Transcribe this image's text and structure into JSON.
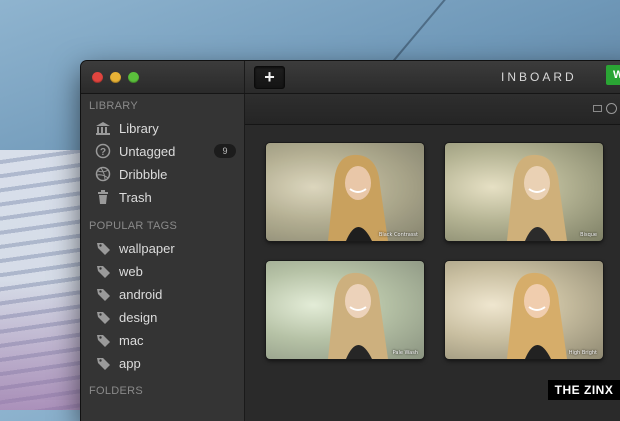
{
  "app": {
    "title": "INBOARD",
    "add_button": "+",
    "green_button": "W"
  },
  "sidebar": {
    "library_heading": "LIBRARY",
    "library_items": [
      {
        "label": "Library",
        "icon": "library-icon"
      },
      {
        "label": "Untagged",
        "icon": "question-icon",
        "count": "9"
      },
      {
        "label": "Dribbble",
        "icon": "dribbble-icon"
      },
      {
        "label": "Trash",
        "icon": "trash-icon"
      }
    ],
    "tags_heading": "POPULAR TAGS",
    "tags": [
      {
        "label": "wallpaper"
      },
      {
        "label": "web"
      },
      {
        "label": "android"
      },
      {
        "label": "design"
      },
      {
        "label": "mac"
      },
      {
        "label": "app"
      }
    ],
    "folders_heading": "FOLDERS"
  },
  "thumbnails": [
    {
      "caption": "Black Contrasst"
    },
    {
      "caption": "Bisque"
    },
    {
      "caption": "Pale Wash"
    },
    {
      "caption": "High Bright"
    }
  ],
  "watermark": "THE ZINX",
  "colors": {
    "window_bg": "#2b2b2b",
    "sidebar_bg": "#343434",
    "close": "#e0453f",
    "minimize": "#e8b236",
    "maximize": "#5bbf3c",
    "accent_green": "#2aa534"
  }
}
